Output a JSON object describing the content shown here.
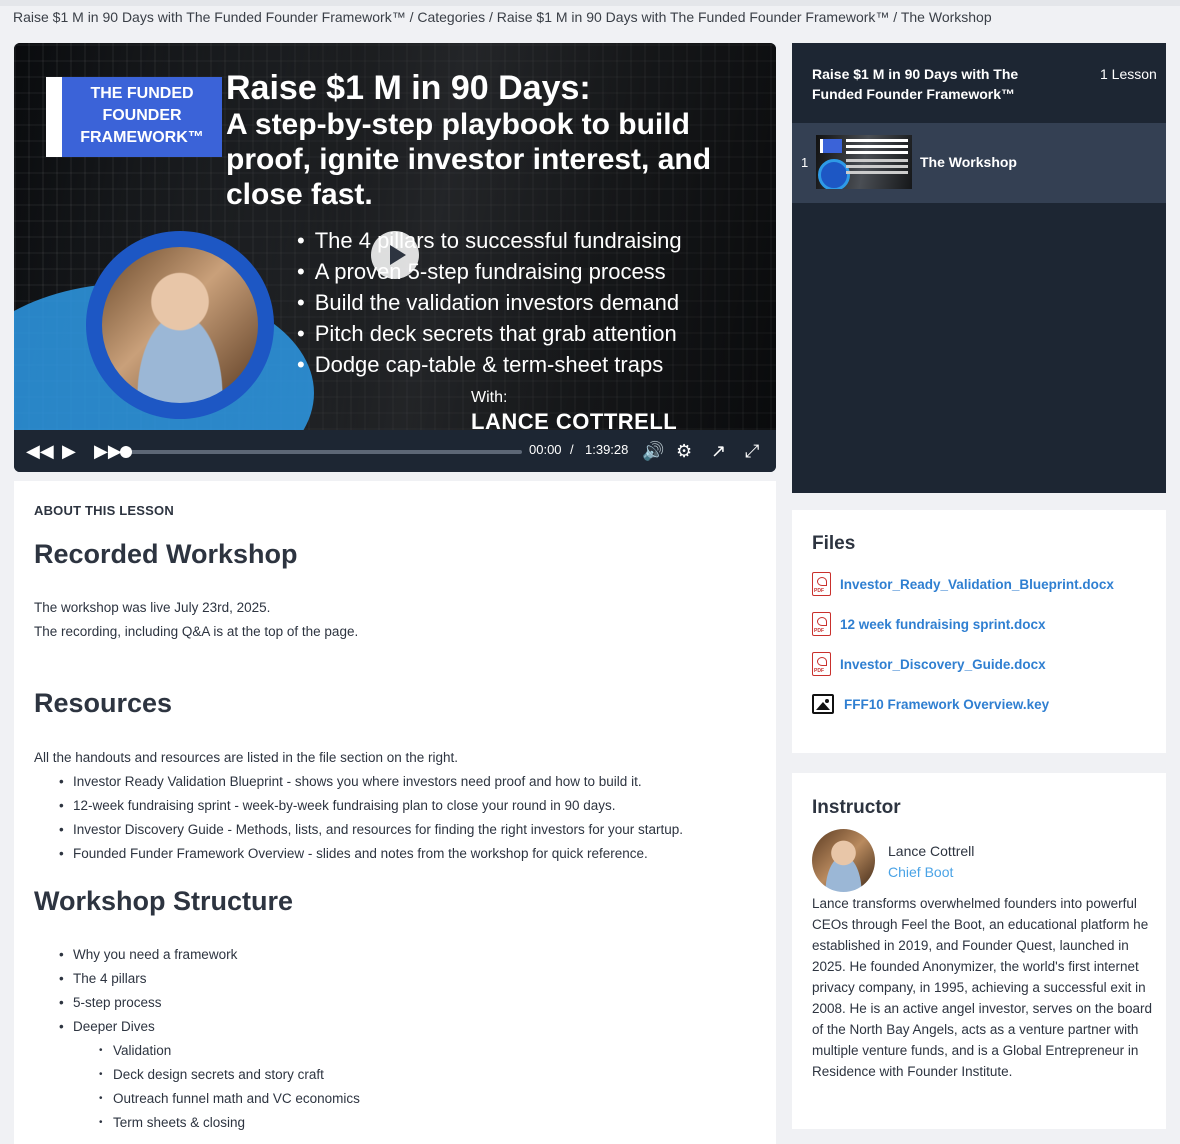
{
  "breadcrumb": "Raise $1 M in 90 Days with The Funded Founder Framework™ / Categories / Raise $1 M in 90 Days with The Funded Founder Framework™ / The Workshop",
  "video": {
    "logo_text": "THE FUNDED FOUNDER FRAMEWORK™",
    "headline": "Raise $1 M in 90 Days:",
    "subheadline": "A step-by-step playbook to build proof, ignite investor interest, and close fast.",
    "bullets": [
      "The 4 pillars to successful fundraising",
      "A proven 5-step fundraising process",
      "Build the validation investors demand",
      "Pitch deck secrets that grab attention",
      "Dodge cap-table & term-sheet traps"
    ],
    "with_label": "With:",
    "presenter": "LANCE COTTRELL",
    "current_time": "00:00",
    "time_sep": "/",
    "duration": "1:39:28",
    "progress": 0.0
  },
  "playlist": {
    "title": "Raise $1 M in 90 Days with The Funded Founder Framework™",
    "count": "1 Lesson",
    "items": [
      {
        "number": "1",
        "label": "The Workshop"
      }
    ]
  },
  "about": {
    "kicker": "ABOUT THIS LESSON",
    "recorded_title": "Recorded Workshop",
    "recorded_line1": "The workshop was live July 23rd, 2025.",
    "recorded_line2": "The recording, including Q&A is at the top of the page.",
    "resources_title": "Resources",
    "resources_intro": "All the handouts and resources are listed in the file section on the right.",
    "resources": [
      "Investor Ready Validation Blueprint - shows you where investors need proof and how to build it.",
      "12-week fundraising sprint - week-by-week fundraising plan to close your round in 90 days.",
      "Investor Discovery Guide - Methods, lists, and resources for finding the right investors for your startup.",
      "Founded Funder Framework Overview - slides and notes from the workshop for quick reference."
    ],
    "structure_title": "Workshop Structure",
    "structure": [
      "Why you need a framework",
      "The 4 pillars",
      "5-step process",
      "Deeper Dives"
    ],
    "deeper_dives": [
      "Validation",
      "Deck design secrets and story craft",
      "Outreach funnel math and VC economics",
      "Term sheets & closing"
    ]
  },
  "files": {
    "title": "Files",
    "items": [
      {
        "name": "Investor_Ready_Validation_Blueprint.docx",
        "icon": "pdf-icon"
      },
      {
        "name": "12 week fundraising sprint.docx",
        "icon": "pdf-icon"
      },
      {
        "name": "Investor_Discovery_Guide.docx",
        "icon": "pdf-icon"
      },
      {
        "name": "FFF10 Framework Overview.key",
        "icon": "image-icon"
      }
    ]
  },
  "instructor": {
    "title": "Instructor",
    "name": "Lance Cottrell",
    "role": "Chief Boot",
    "bio": "Lance transforms overwhelmed founders into powerful CEOs through Feel the Boot, an educational platform he established in 2019, and Founder Quest, launched in 2025. He founded Anonymizer, the world's first internet privacy company, in 1995, achieving a successful exit in 2008. He is an active angel investor, serves on the board of the North Bay Angels, acts as a venture partner with multiple venture funds, and is a Global Entrepreneur in Residence with Founder Institute."
  },
  "colors": {
    "dark_panel": "#1d2633",
    "active_item": "#344053",
    "link": "#2f7fd1",
    "role": "#4aa3e6"
  }
}
